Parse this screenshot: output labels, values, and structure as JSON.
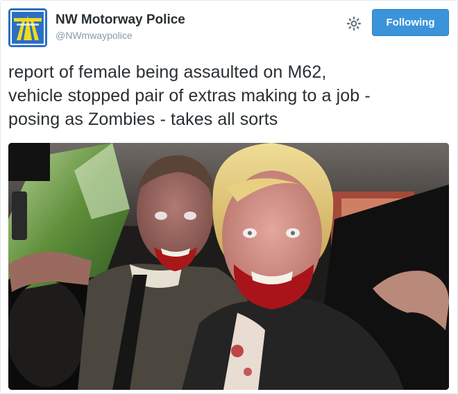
{
  "account": {
    "display_name": "NW Motorway Police",
    "handle": "@NWmwaypolice",
    "avatar_icon": "motorway-sign-icon"
  },
  "actions": {
    "settings_icon": "gear-icon",
    "follow_label": "Following",
    "follow_color": "#3b94d9"
  },
  "tweet": {
    "text_line1": "report of female being assaulted on M62,",
    "text_line2": "vehicle stopped pair of extras making to a job -",
    "text_line3": "posing as Zombies - takes all sorts"
  },
  "media": {
    "kind": "photo"
  }
}
